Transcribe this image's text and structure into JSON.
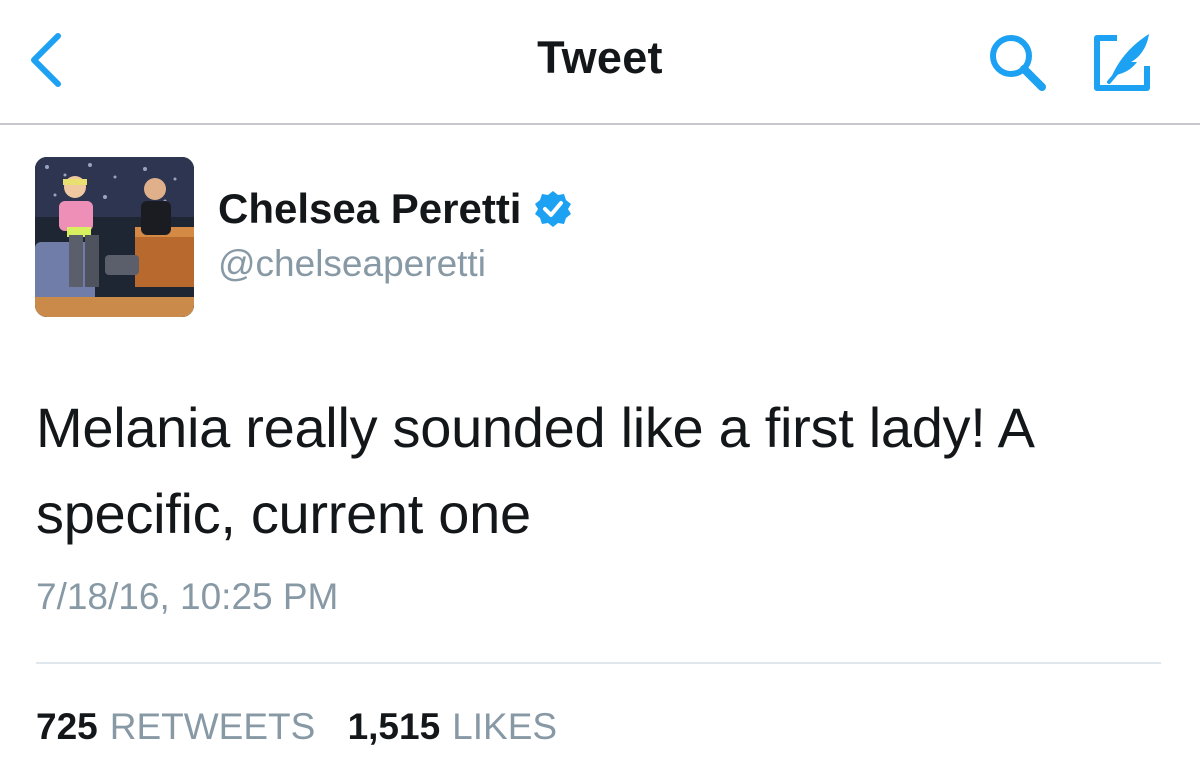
{
  "nav": {
    "title": "Tweet",
    "back_icon": "chevron-left-icon",
    "search_icon": "search-icon",
    "compose_icon": "compose-tweet-icon"
  },
  "tweet": {
    "author": {
      "display_name": "Chelsea Peretti",
      "handle": "@chelseaperetti",
      "verified": true
    },
    "text": "Melania really sounded like a first lady! A specific, current one",
    "timestamp": "7/18/16, 10:25 PM",
    "stats": {
      "retweets_count": "725",
      "retweets_label": "RETWEETS",
      "likes_count": "1,515",
      "likes_label": "LIKES"
    }
  },
  "colors": {
    "accent": "#1da1f2",
    "text_primary": "#14171a",
    "text_secondary": "#8899a6",
    "divider": "#e1e8ed"
  }
}
